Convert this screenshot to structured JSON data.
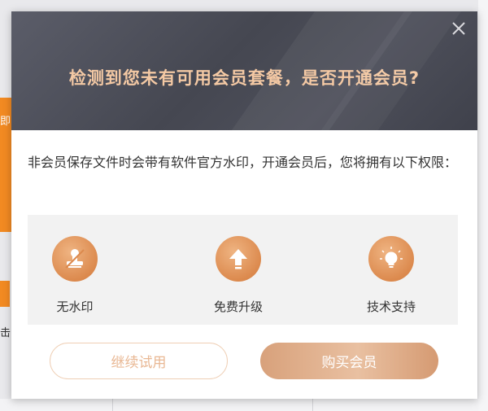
{
  "dialog": {
    "title": "检测到您未有可用会员套餐，是否开通会员?",
    "description": "非会员保存文件时会带有软件官方水印，开通会员后，您将拥有以下权限：",
    "features": [
      {
        "label": "无水印",
        "icon": "stamp-icon"
      },
      {
        "label": "免费升级",
        "icon": "upgrade-arrow-icon"
      },
      {
        "label": "技术支持",
        "icon": "lightbulb-icon"
      }
    ],
    "trial_button": "继续试用",
    "buy_button": "购买会员",
    "close_icon": "close-icon"
  },
  "background": {
    "left_partial_char": "即",
    "left_partial_text": "击"
  },
  "colors": {
    "accent": "#dc8a4e",
    "title": "#f4c9a4",
    "header_bg": "#4a4c57"
  }
}
